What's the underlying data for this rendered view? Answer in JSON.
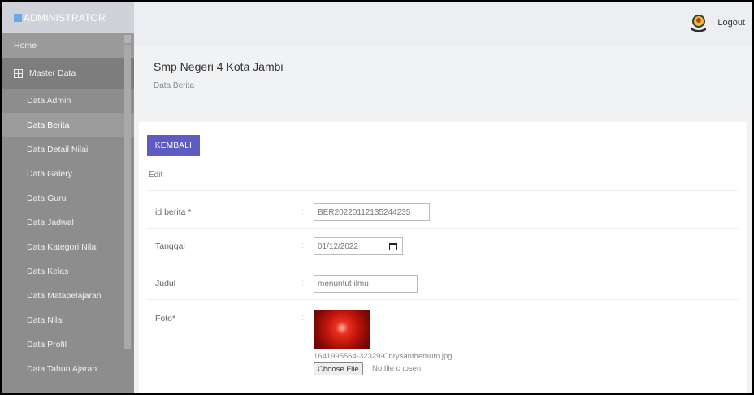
{
  "brand": {
    "title": "ADMINISTRATOR"
  },
  "topbar": {
    "logout_label": "Logout",
    "emblem_icon": "school-emblem-icon"
  },
  "sidebar": {
    "home_label": "Home",
    "master_label": "Master Data",
    "items": [
      {
        "label": "Data Admin",
        "active": false
      },
      {
        "label": "Data Berita",
        "active": true
      },
      {
        "label": "Data Detail Nilai",
        "active": false
      },
      {
        "label": "Data Galery",
        "active": false
      },
      {
        "label": "Data Guru",
        "active": false
      },
      {
        "label": "Data Jadwal",
        "active": false
      },
      {
        "label": "Data Kategori Nilai",
        "active": false
      },
      {
        "label": "Data Kelas",
        "active": false
      },
      {
        "label": "Data Matapelajaran",
        "active": false
      },
      {
        "label": "Data Nilai",
        "active": false
      },
      {
        "label": "Data Profil",
        "active": false
      },
      {
        "label": "Data Tahun Ajaran",
        "active": false
      }
    ]
  },
  "header": {
    "title": "Smp Negeri 4 Kota Jambi",
    "subtitle": "Data Berita"
  },
  "form": {
    "back_label": "KEMBALI",
    "mode_label": "Edit",
    "colon": ":",
    "id_label": "id berita *",
    "id_value": "BER20220112135244235",
    "date_label": "Tanggal",
    "date_value": "01/12/2022",
    "title_label": "Judul",
    "title_value": "menuntut ilmu",
    "photo_label": "Foto*",
    "photo_filename": "1641995564-32329-Chrysanthemum.jpg",
    "choose_label": "Choose File",
    "no_file_label": "No file chosen"
  },
  "colors": {
    "accent": "#5e5bc2",
    "sidebar": "#8d8d8d"
  }
}
